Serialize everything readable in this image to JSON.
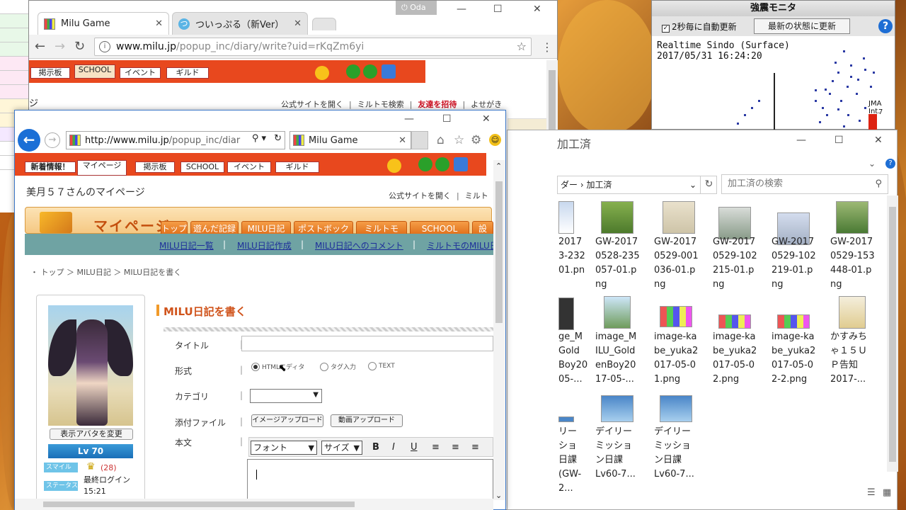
{
  "chrome": {
    "tabs": [
      {
        "title": "Milu Game",
        "active": true
      },
      {
        "title": "ついっぷる（新Ver）",
        "active": false
      }
    ],
    "user": "Oda",
    "url_host": "www.milu.jp",
    "url_path": "/popup_inc/diary/write?uid=rKqZm6yi",
    "nav_buttons": [
      "掲示板",
      "SCHOOL",
      "イベント",
      "ギルド"
    ],
    "left_text": "ジ",
    "links": [
      "公式サイトを開く",
      "ミルトモ検索",
      "友達を招待",
      "よせがき"
    ]
  },
  "ie": {
    "url_host": "http://www.milu.jp",
    "url_path": "/popup_inc/diar",
    "tab_title": "Milu Game",
    "nav_buttons": [
      "新着情報！",
      "マイページ",
      "掲示板",
      "SCHOOL",
      "イベント",
      "ギルド"
    ],
    "owner_title": "美月５７さんのマイページ",
    "top_links": [
      "公式サイトを開く",
      "ミルト"
    ],
    "banner_title": "マイページ",
    "banner_tabs": [
      "トップ",
      "遊んだ記録",
      "MILU日記",
      "ポストボックス",
      "ミルトモ",
      "SCHOOL",
      "設"
    ],
    "subnav": [
      "MILU日記一覧",
      "MILU日記作成",
      "MILU日記へのコメント",
      "ミルトモのMILU日"
    ],
    "breadcrumb": "・ トップ ＞ MILU日記 ＞ MILU日記を書く",
    "avatar_change": "表示アバタを変更",
    "level": "Lv 70",
    "smile_tag": "スマイル",
    "smile_count": "(28)",
    "status_tag": "ステータス",
    "last_login_label": "最終ログイン",
    "last_login_time": "15:21",
    "form": {
      "title": "MILU日記を書く",
      "label_title": "タイトル",
      "label_format": "形式",
      "format_options": [
        "HTMLエディタ",
        "タグ入力",
        "TEXT"
      ],
      "label_category": "カテゴリ",
      "label_attach": "添付ファイル",
      "upload_image": "イメージアップロード",
      "upload_video": "動画アップロード",
      "label_body": "本文",
      "font_select": "フォント",
      "size_select": "サイズ",
      "bold": "B",
      "italic": "I",
      "underline": "U"
    }
  },
  "explorer": {
    "title": "加工済",
    "path_prefix": "ダー",
    "path_folder": "加工済",
    "search_placeholder": "加工済の検索",
    "files": [
      {
        "name": "GW-2017\n0528-235\n057-01.p\nng"
      },
      {
        "name": "GW-2017\n0529-001\n036-01.p\nng"
      },
      {
        "name": "GW-2017\n0529-102\n215-01.p\nng"
      },
      {
        "name": "GW-2017\n0529-102\n219-01.p\nng"
      },
      {
        "name": "GW-2017\n0529-153\n448-01.p\nng"
      },
      {
        "name": "image_M\nILU_Gold\nenBoy20\n17-05-..."
      },
      {
        "name": "image-ka\nbe_yuka2\n017-05-0\n1.png"
      },
      {
        "name": "image-ka\nbe_yuka2\n017-05-0\n2.png"
      },
      {
        "name": "image-ka\nbe_yuka2\n017-05-0\n2-2.png"
      },
      {
        "name": "かすみち\nゃ１５Ｕ\nＰ告知\n2017-..."
      },
      {
        "name": "デイリー\nミッショ\nン日課\nLv60-7..."
      },
      {
        "name": "デイリー\nミッショ\nン日課\nLv60-7..."
      }
    ],
    "partial_row1": "2017\n3-232\n01.pn",
    "partial_row2": "ge_M\nGold\nBoy20\n05-...",
    "partial_row3": "リー\nショ\n日課\n(GW-2..."
  },
  "monitor": {
    "title": "強震モニタ",
    "auto_update": "2秒毎に自動更新",
    "update_button": "最新の状態に更新",
    "line1": "Realtime Sindo (Surface)",
    "line2": "2017/05/31 16:24:20",
    "jma": "JMA Int.",
    "scale_top": "7"
  }
}
